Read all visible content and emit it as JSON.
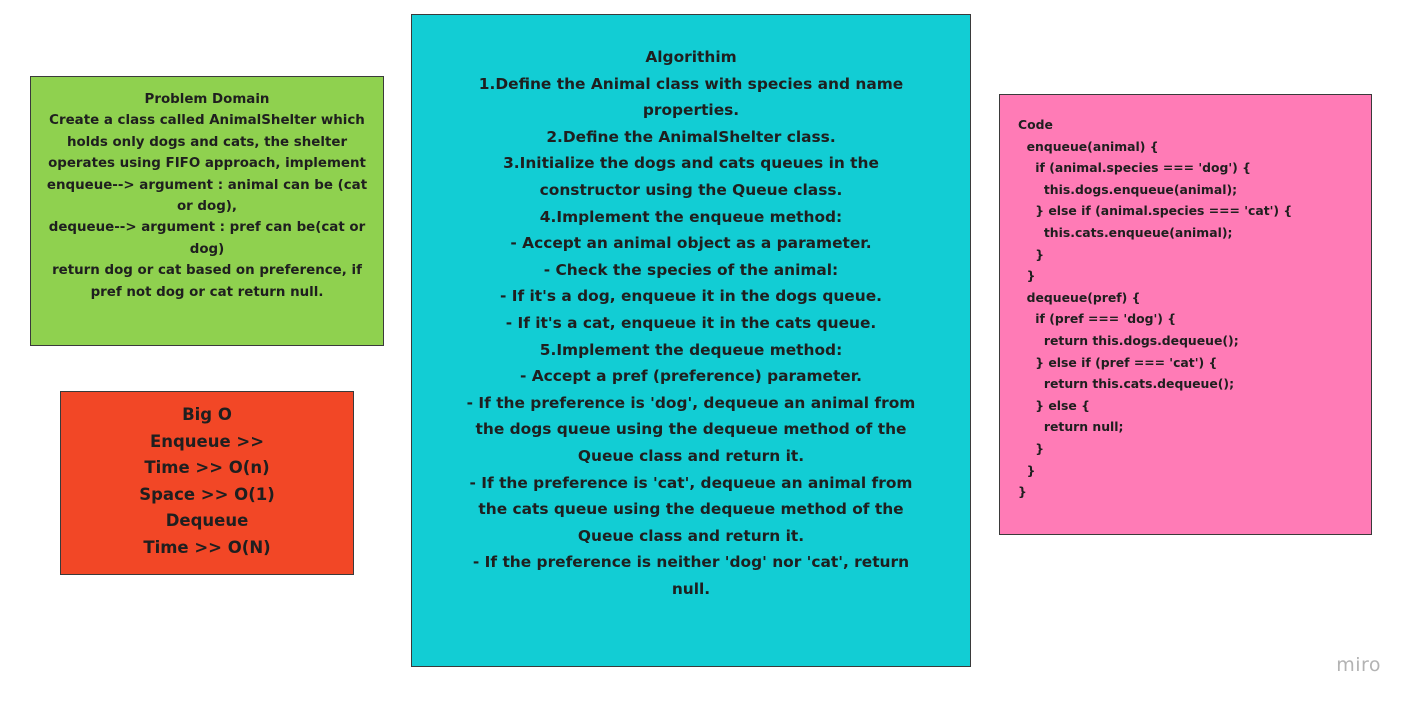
{
  "problem_domain": {
    "lines": [
      "Problem Domain",
      "Create a class called AnimalShelter which",
      "holds only dogs and cats, the shelter",
      "operates using FIFO approach, implement",
      "enqueue--> argument : animal can be (cat",
      "or dog),",
      "dequeue--> argument : pref can be(cat or",
      "dog)",
      "return dog or cat based on preference, if",
      "pref not dog or cat return null."
    ],
    "color": "#8fd14f"
  },
  "big_o": {
    "lines": [
      "Big O",
      "Enqueue >>",
      "Time >> O(n)",
      "Space >> O(1)",
      "Dequeue",
      "Time >> O(N)"
    ],
    "color": "#f24726"
  },
  "algorithm": {
    "lines": [
      "Algorithim",
      "1.Define the Animal class with species and name",
      "properties.",
      "2.Define the AnimalShelter class.",
      "3.Initialize the dogs and cats queues in the",
      "constructor using the Queue class.",
      "4.Implement the enqueue method:",
      "- Accept an animal object as a parameter.",
      "- Check the species of the animal:",
      "- If it's a dog, enqueue it in the dogs queue.",
      "- If it's a cat, enqueue it in the cats queue.",
      "5.Implement the dequeue method:",
      "- Accept a pref (preference) parameter.",
      "- If the preference is 'dog', dequeue an animal from",
      "the dogs queue using the dequeue method of the",
      "Queue class and return it.",
      "- If the preference is 'cat', dequeue an animal from",
      "the cats queue using the dequeue method of the",
      "Queue class and return it.",
      "- If the preference is neither 'dog' nor 'cat', return",
      "null."
    ],
    "color": "#12cdd4"
  },
  "code": {
    "lines": [
      "Code",
      "  enqueue(animal) {",
      "    if (animal.species === 'dog') {",
      "      this.dogs.enqueue(animal);",
      "    } else if (animal.species === 'cat') {",
      "      this.cats.enqueue(animal);",
      "    }",
      "  }",
      "  dequeue(pref) {",
      "    if (pref === 'dog') {",
      "      return this.dogs.dequeue();",
      "    } else if (pref === 'cat') {",
      "      return this.cats.dequeue();",
      "    } else {",
      "      return null;",
      "    }",
      "  }",
      "}"
    ],
    "color": "#ff7bb6"
  },
  "watermark": {
    "text": "miro"
  }
}
